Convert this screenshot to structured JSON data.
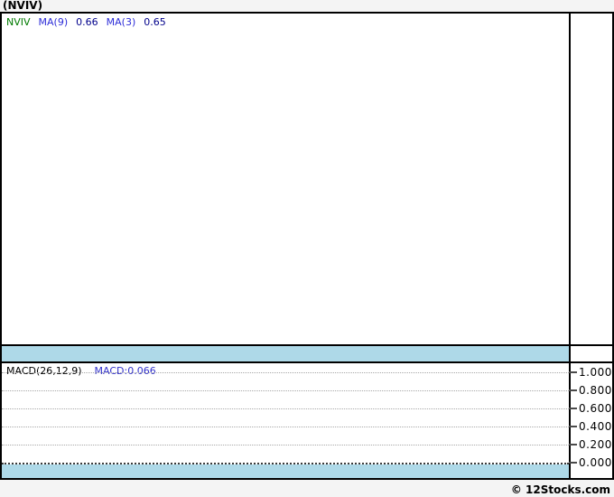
{
  "header": {
    "title": "(NVIV)"
  },
  "price_panel": {
    "legend": {
      "symbol": "NVIV",
      "ma9_label": "MA(9)",
      "ma9_value": "0.66",
      "ma3_label": "MA(3)",
      "ma3_value": "0.65"
    }
  },
  "macd": {
    "label": "MACD(26,12,9)",
    "value": "MACD:0.066",
    "ticks": [
      "1.000",
      "0.800",
      "0.600",
      "0.400",
      "0.200",
      "0.000"
    ]
  },
  "footer": {
    "credit": "© 12Stocks.com"
  },
  "colors": {
    "page_bg": "#f4f4f4",
    "panel_bg": "#ffffff",
    "border_black": "#000000",
    "band_blue": "#aed9e8",
    "symbol_green": "#007a00",
    "ma_blue": "#2d2dd8",
    "value_navy": "#00008b",
    "macd_value_blue": "#3333cc",
    "grid_gray": "#a8a8a8",
    "zero_line": "#3a3a3a"
  },
  "chart_data": [
    {
      "type": "line",
      "title": "NVIV price panel",
      "series": [
        {
          "name": "NVIV",
          "values": []
        },
        {
          "name": "MA(9)",
          "last_value": 0.66,
          "values": []
        },
        {
          "name": "MA(3)",
          "last_value": 0.65,
          "values": []
        }
      ],
      "note": "panel is empty - no plotted candles or lines visible",
      "grid": false,
      "legend_position": "top-left"
    },
    {
      "type": "line",
      "title": "MACD(26,12,9)",
      "series": [
        {
          "name": "MACD",
          "last_value": 0.066,
          "values": []
        }
      ],
      "ylim": [
        0.0,
        1.0
      ],
      "yticks": [
        1.0,
        0.8,
        0.6,
        0.4,
        0.2,
        0.0
      ],
      "ytick_labels": [
        "1.000",
        "0.800",
        "0.600",
        "0.400",
        "0.200",
        "0.000"
      ],
      "grid": "dotted horizontal, zero line emphasized",
      "note": "panel is empty - no plotted MACD line or histogram visible",
      "legend_position": "top-left"
    }
  ]
}
